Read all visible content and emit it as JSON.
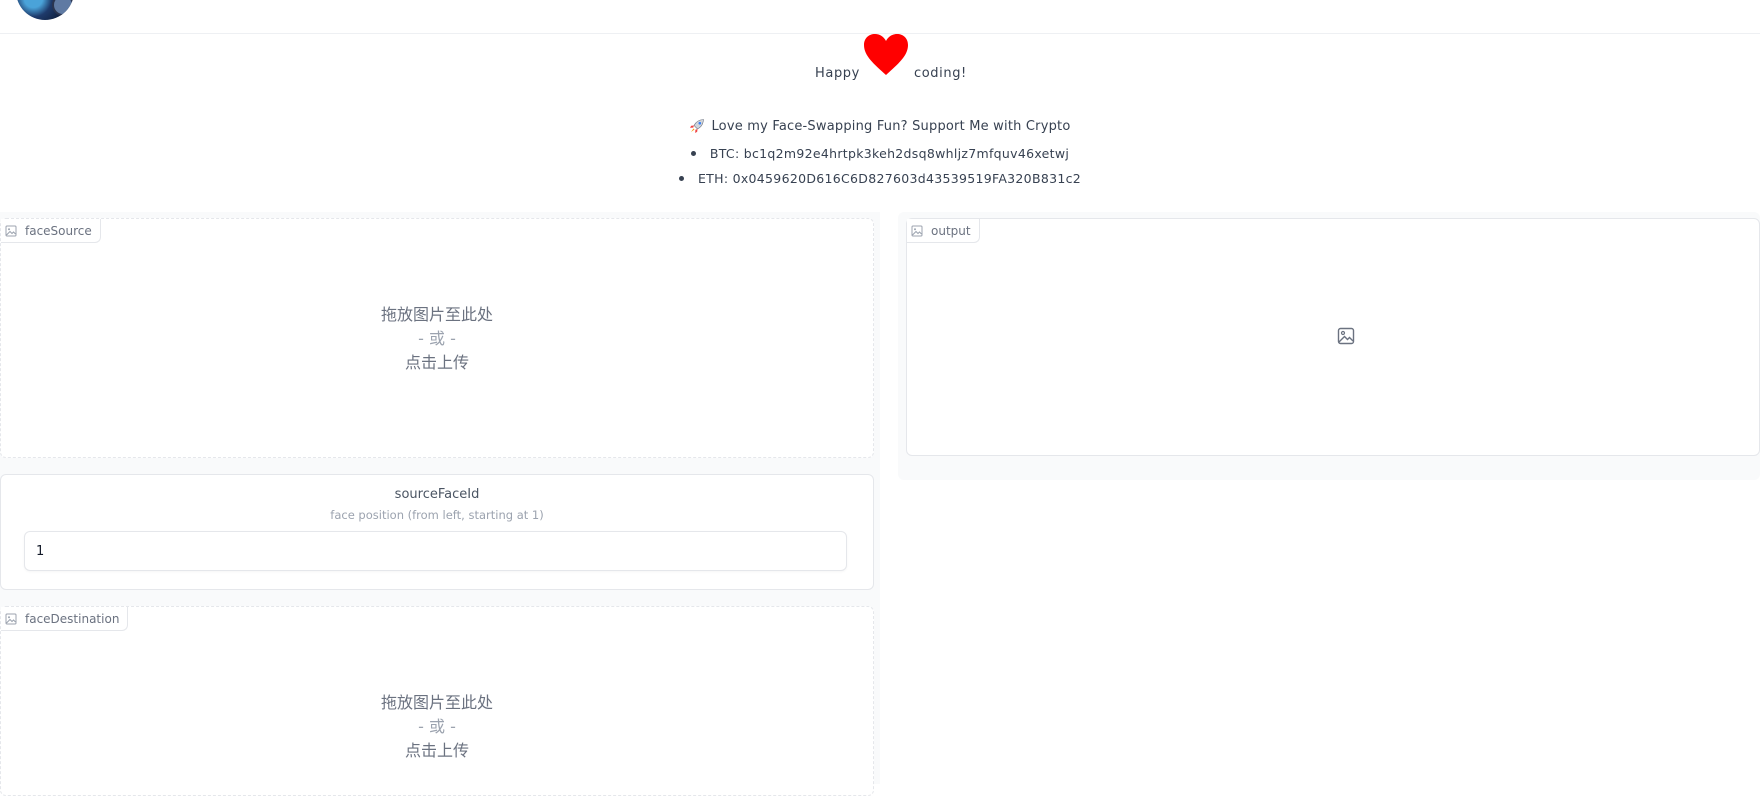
{
  "header": {
    "happy_left": "Happy",
    "happy_right": "coding!",
    "heart_color": "#ff0000",
    "crypto_title": "Love my Face-Swapping Fun? Support Me with Crypto",
    "rocket_icon": "rocket-icon",
    "addresses": [
      "BTC: bc1q2m92e4hrtpk3keh2dsq8whljz7mfquv46xetwj",
      "ETH: 0x0459620D616C6D827603d43539519FA320B831c2"
    ]
  },
  "face_source": {
    "label": "faceSource",
    "drop_line1": "拖放图片至此处",
    "drop_or": "- 或 -",
    "drop_line2": "点击上传"
  },
  "source_face_id": {
    "label": "sourceFaceId",
    "info": "face position (from left, starting at 1)",
    "value": "1"
  },
  "face_destination": {
    "label": "faceDestination",
    "drop_line1": "拖放图片至此处",
    "drop_or": "- 或 -",
    "drop_line2": "点击上传"
  },
  "output": {
    "label": "output",
    "placeholder_icon": "image-icon"
  }
}
